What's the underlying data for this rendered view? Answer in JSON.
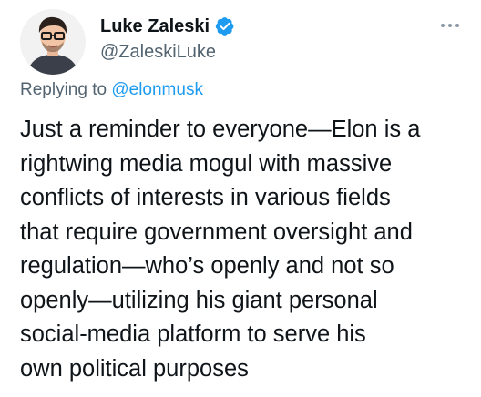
{
  "author": {
    "display_name": "Luke Zaleski",
    "handle": "@ZaleskiLuke",
    "verified": true,
    "verified_color": "#1d9bf0"
  },
  "reply": {
    "prefix": "Replying to",
    "mention": "@elonmusk"
  },
  "tweet": {
    "lines": [
      "Just a reminder to everyone—Elon is a",
      "rightwing media mogul with massive",
      "conflicts of interests in various fields",
      "that require government oversight and",
      "regulation—who’s openly and not so",
      "openly—utilizing his giant personal",
      "social-media platform to serve his",
      "own political purposes"
    ]
  },
  "icons": {
    "verified": "verified-badge-icon",
    "more": "more-options-icon"
  },
  "colors": {
    "text": "#0f1419",
    "secondary": "#536471",
    "link": "#1d9bf0"
  }
}
